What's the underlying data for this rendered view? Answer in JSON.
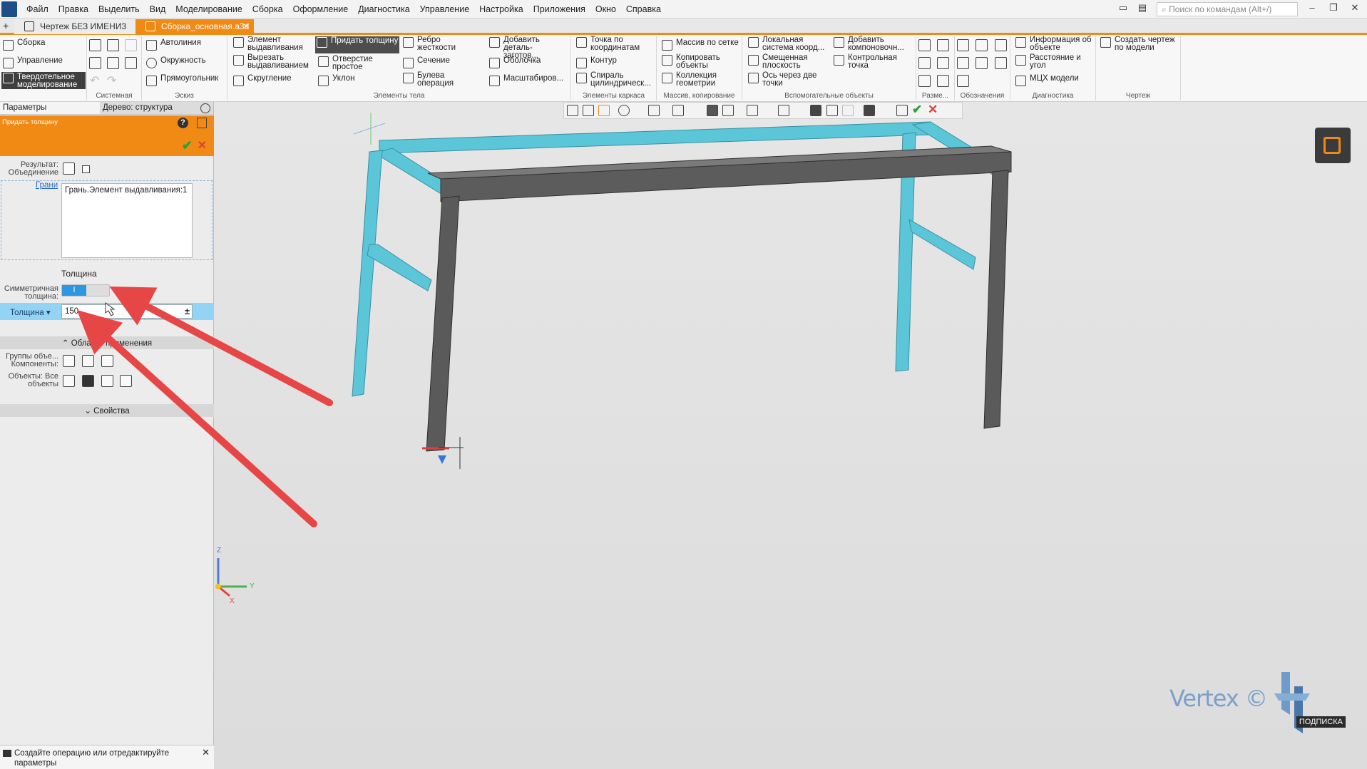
{
  "menu": [
    "Файл",
    "Правка",
    "Выделить",
    "Вид",
    "Моделирование",
    "Сборка",
    "Оформление",
    "Диагностика",
    "Управление",
    "Настройка",
    "Приложения",
    "Окно",
    "Справка"
  ],
  "search_placeholder": "Поиск по командам (Alt+/)",
  "tabs": [
    {
      "label": "Чертеж БЕЗ ИМЕНИ3",
      "active": false
    },
    {
      "label": "Сборка_основная.a3d",
      "active": true
    }
  ],
  "ribbon": {
    "modes": [
      "Сборка",
      "Управление",
      "Твердотельное моделирование"
    ],
    "sketch": [
      "Автолиния",
      "Окружность",
      "Прямоугольник"
    ],
    "body": [
      "Элемент выдавливания",
      "Вырезать выдавливанием",
      "Скругление",
      "Придать толщину",
      "Отверстие простое",
      "Уклон",
      "Ребро жесткости",
      "Сечение",
      "Булева операция",
      "Добавить деталь-заготов...",
      "Оболочка",
      "Масштабиров..."
    ],
    "frame": [
      "Точка по координатам",
      "Контур",
      "Спираль цилиндрическ..."
    ],
    "array": [
      "Массив по сетке",
      "Копировать объекты",
      "Коллекция геометрии"
    ],
    "aux": [
      "Локальная система коорд...",
      "Смещенная плоскость",
      "Ось через две точки",
      "Добавить компоновочн...",
      "Контрольная точка"
    ],
    "diag": [
      "Информация об объекте",
      "Расстояние и угол",
      "МЦХ модели"
    ],
    "drawing": [
      "Создать чертеж по модели"
    ],
    "groups": [
      "Системная",
      "Эскиз",
      "Элементы тела",
      "Элементы каркаса",
      "Массив, копирование",
      "Вспомогательные объекты",
      "Разме...",
      "Обозначения",
      "Диагностика",
      "Чертеж"
    ]
  },
  "panel": {
    "tabs": [
      "Параметры",
      "Дерево: структура"
    ],
    "operation_title": "Придать толщину",
    "result_label": "Результат: Объединение",
    "faces_link": "Грани",
    "faces_value": "Грань.Элемент выдавливания:1",
    "thickness_title": "Толщина",
    "symmetric_label": "Симметричная толщина:",
    "toggle_text": "I",
    "thickness_label": "Толщина",
    "thickness_value": "150",
    "pm": "±",
    "scope_section": "Область применения",
    "groups_label": "Группы объе... Компоненты:",
    "objects_label": "Объекты: Все объекты",
    "props_section": "Свойства",
    "status": "Создайте операцию или отредактируйте параметры"
  },
  "brand": {
    "name": "Vertex",
    "sub": "ПОДПИСКА"
  },
  "colors": {
    "accent": "#f08a14",
    "cyan_beam": "#4fc7dd",
    "dark_beam": "#5a5a5a",
    "arrow": "#e64646"
  }
}
